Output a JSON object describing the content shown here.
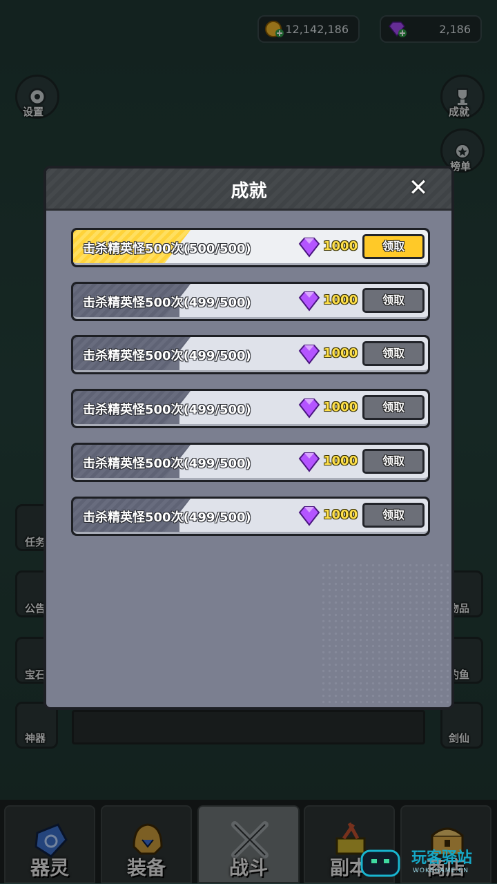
{
  "currency": {
    "coins": "12,142,186",
    "gems": "2,186"
  },
  "left_buttons": {
    "settings": "设置",
    "quest": "任务",
    "notice": "公告",
    "treasure": "宝石",
    "artifact": "神器"
  },
  "right_buttons": {
    "achievement": "成就",
    "ranking": "榜单",
    "items": "物品",
    "fishing": "钓鱼",
    "sword": "剑仙"
  },
  "dialog": {
    "title": "成就",
    "close": "✕",
    "achievements": [
      {
        "text": "击杀精英怪500次(500/500)",
        "reward": "1000",
        "button": "领取",
        "claimable": true
      },
      {
        "text": "击杀精英怪500次(499/500)",
        "reward": "1000",
        "button": "领取",
        "claimable": false
      },
      {
        "text": "击杀精英怪500次(499/500)",
        "reward": "1000",
        "button": "领取",
        "claimable": false
      },
      {
        "text": "击杀精英怪500次(499/500)",
        "reward": "1000",
        "button": "领取",
        "claimable": false
      },
      {
        "text": "击杀精英怪500次(499/500)",
        "reward": "1000",
        "button": "领取",
        "claimable": false
      },
      {
        "text": "击杀精英怪500次(499/500)",
        "reward": "1000",
        "button": "领取",
        "claimable": false
      }
    ]
  },
  "bottom_nav": {
    "tabs": [
      {
        "label": "器灵",
        "icon": "spirit-stone-icon"
      },
      {
        "label": "装备",
        "icon": "helmet-icon"
      },
      {
        "label": "战斗",
        "icon": "crossed-swords-icon",
        "active": true
      },
      {
        "label": "副本",
        "icon": "dungeon-icon"
      },
      {
        "label": "商店",
        "icon": "treasure-chest-icon"
      }
    ]
  },
  "watermark": {
    "name": "玩客驿站",
    "url": "WOKEGAME.CN"
  },
  "colors": {
    "accent_gold": "#ffc928",
    "gem_purple": "#b455ff",
    "dialog_bg": "#7b7f90"
  }
}
